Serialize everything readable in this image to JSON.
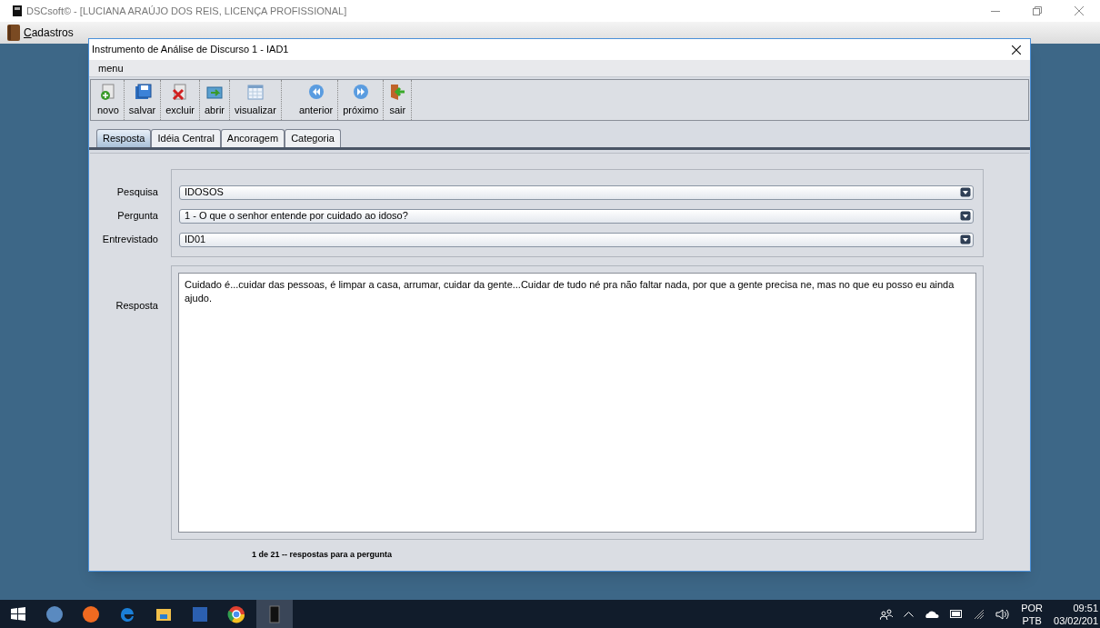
{
  "app_window": {
    "title": "DSCsoft© - [LUCIANA ARAÚJO DOS REIS,  LICENÇA PROFISSIONAL]",
    "menu": [
      {
        "label": "Cadastros"
      }
    ]
  },
  "dialog": {
    "title": "Instrumento de Análise de Discurso 1 - IAD1",
    "menu": [
      "menu"
    ],
    "toolbar": [
      "novo",
      "salvar",
      "excluir",
      "abrir",
      "visualizar",
      "anterior",
      "próximo",
      "sair"
    ],
    "tabs": [
      {
        "label": "Resposta",
        "selected": true
      },
      {
        "label": "Idéia Central",
        "selected": false
      },
      {
        "label": "Ancoragem",
        "selected": false
      },
      {
        "label": "Categoria",
        "selected": false
      }
    ],
    "fields": [
      {
        "label": "Pesquisa",
        "value": "IDOSOS"
      },
      {
        "label": "Pergunta",
        "value": "1 - O que o senhor entende por cuidado ao idoso?"
      },
      {
        "label": "Entrevistado",
        "value": "ID01"
      }
    ],
    "answer": {
      "label": "Resposta",
      "value": "Cuidado é...cuidar das pessoas, é limpar a casa, arrumar, cuidar da gente...Cuidar de tudo né pra não faltar nada, por que a gente precisa ne, mas no que eu posso eu ainda ajudo."
    },
    "status": "1 de 21 -- respostas para a pergunta"
  },
  "taskbar": {
    "tray": {
      "language": "POR",
      "layout": "PTB",
      "time": "09:51",
      "date": "03/02/201"
    }
  }
}
